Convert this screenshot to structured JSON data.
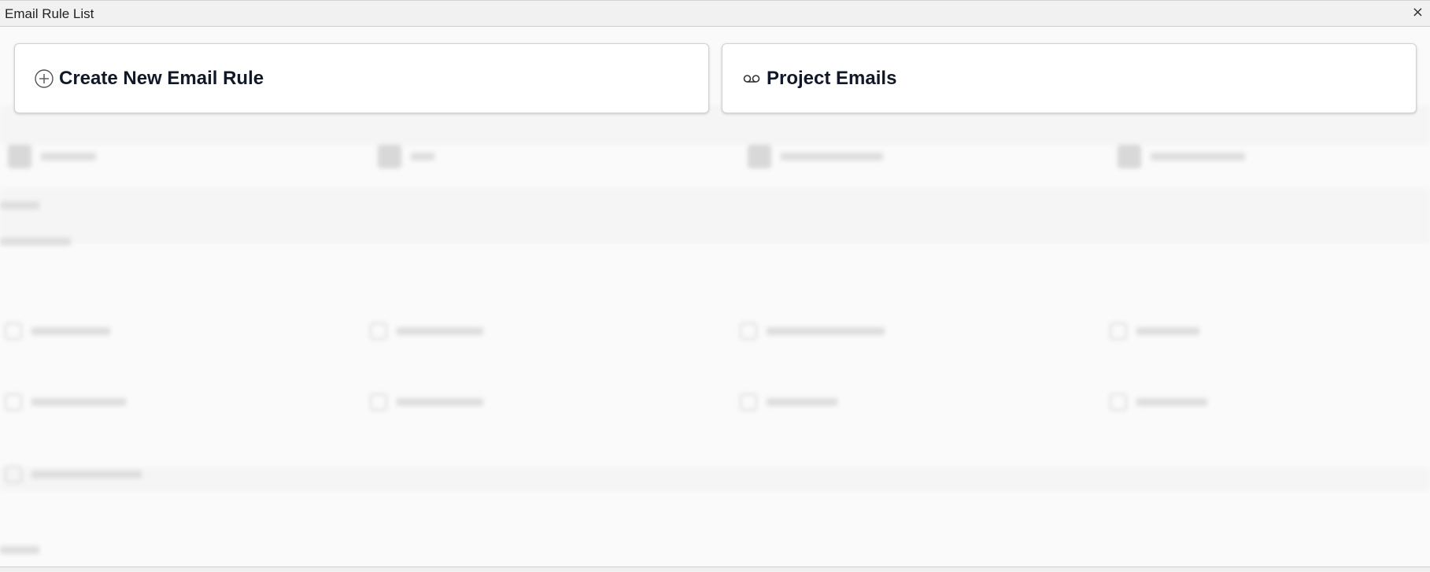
{
  "window": {
    "title": "Email Rule List",
    "close_glyph": "×"
  },
  "cards": {
    "create": {
      "label": "Create New Email Rule",
      "icon": "plus-circle-icon"
    },
    "project": {
      "label": "Project Emails",
      "icon": "voicemail-icon"
    }
  },
  "colors": {
    "card_text": "#111827",
    "card_border": "#d2d2d2",
    "background": "#fafafa"
  }
}
